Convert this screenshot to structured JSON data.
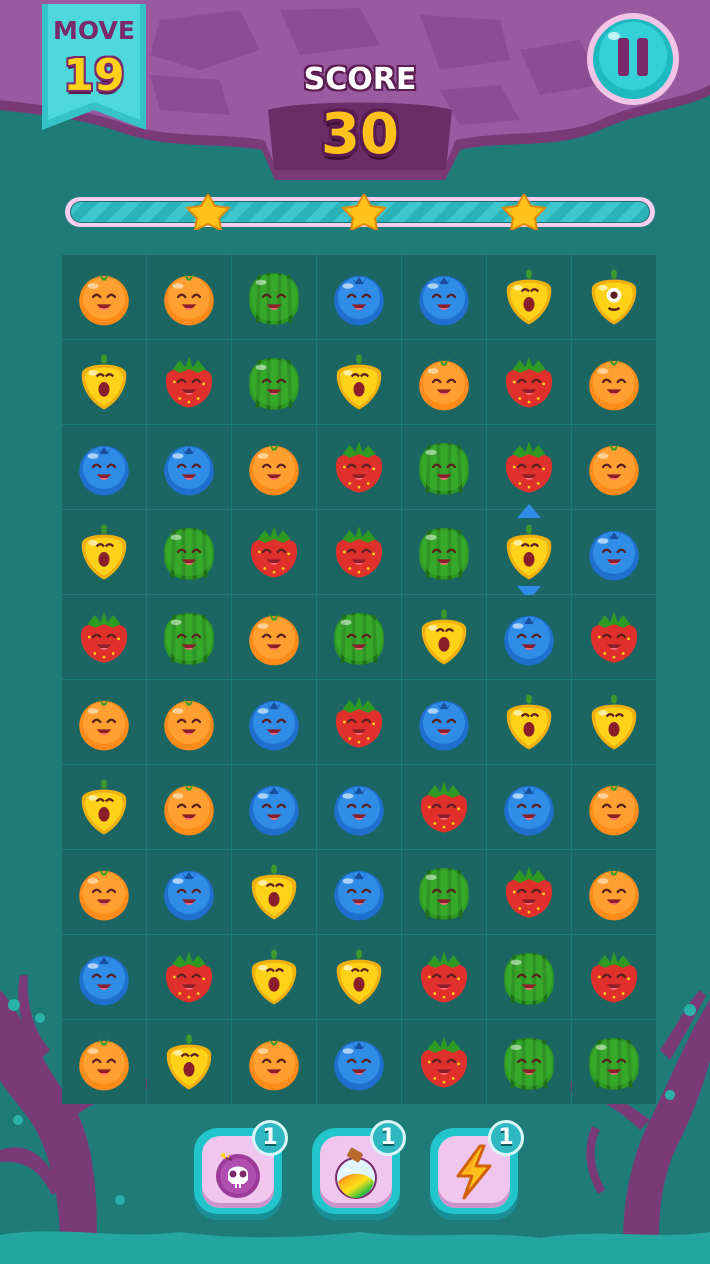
{
  "hud": {
    "move_label": "MOVE",
    "move_value": "19",
    "score_label": "SCORE",
    "score_value": "30"
  },
  "progress": {
    "fill_fraction": 0.0,
    "stars": 3
  },
  "board": {
    "columns": 7,
    "rows": [
      [
        "orange",
        "orange",
        "watermelon",
        "blueberry",
        "blueberry",
        "pepper",
        "pepper-special"
      ],
      [
        "pepper",
        "strawberry",
        "watermelon",
        "pepper",
        "orange",
        "strawberry",
        "orange"
      ],
      [
        "blueberry",
        "blueberry",
        "orange",
        "strawberry",
        "watermelon",
        "strawberry",
        "orange"
      ],
      [
        "pepper",
        "watermelon",
        "strawberry",
        "strawberry",
        "watermelon",
        "pepper-hint",
        "blueberry"
      ],
      [
        "strawberry",
        "watermelon",
        "orange",
        "watermelon",
        "pepper",
        "blueberry",
        "strawberry"
      ],
      [
        "orange",
        "orange",
        "blueberry",
        "strawberry",
        "blueberry",
        "pepper",
        "pepper"
      ],
      [
        "pepper",
        "orange",
        "blueberry",
        "blueberry",
        "strawberry",
        "blueberry",
        "orange"
      ],
      [
        "orange",
        "blueberry",
        "pepper",
        "blueberry",
        "watermelon",
        "strawberry",
        "orange"
      ],
      [
        "blueberry",
        "strawberry",
        "pepper",
        "pepper",
        "strawberry",
        "watermelon",
        "strawberry"
      ],
      [
        "orange",
        "pepper",
        "orange",
        "blueberry",
        "strawberry",
        "watermelon",
        "watermelon"
      ]
    ]
  },
  "boosters": [
    {
      "icon": "skull-bomb-icon",
      "count": "1"
    },
    {
      "icon": "rainbow-potion-icon",
      "count": "1"
    },
    {
      "icon": "lightning-icon",
      "count": "1"
    }
  ],
  "colors": {
    "background": "#1f7b77",
    "rock": "#8a4a8e",
    "orange": "#ff8c1a",
    "watermelon": "#3fb832",
    "blueberry": "#2f8de8",
    "strawberry": "#e0302c",
    "pepper": "#ffd21a"
  }
}
